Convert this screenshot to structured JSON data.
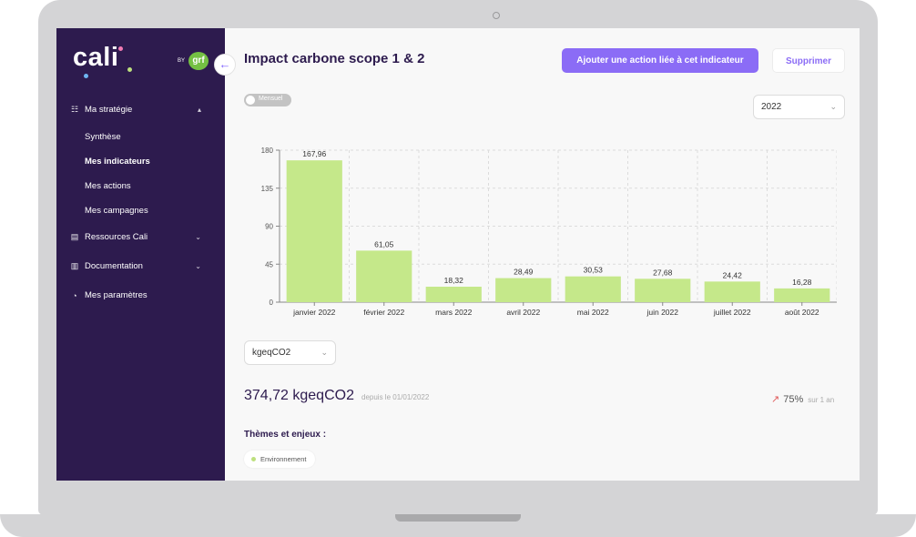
{
  "app": {
    "logo_text": "cali",
    "by_label": "BY",
    "partner_logo": "grf",
    "colors": {
      "sidebar": "#2d1b4e",
      "accent": "#8b6cf6",
      "bar": "#c5e88a",
      "partner": "#74c043"
    }
  },
  "sidebar": {
    "collapse_icon": "arrow-left-icon",
    "items": [
      {
        "label": "Ma stratégie",
        "icon": "strategy-icon",
        "expanded": true
      },
      {
        "label": "Ressources Cali",
        "icon": "book-icon",
        "expanded": false
      },
      {
        "label": "Documentation",
        "icon": "document-icon",
        "expanded": false
      },
      {
        "label": "Mes paramètres",
        "icon": "settings-icon"
      }
    ],
    "subitems": [
      {
        "label": "Synthèse",
        "active": false
      },
      {
        "label": "Mes indicateurs",
        "active": true
      },
      {
        "label": "Mes actions",
        "active": false
      },
      {
        "label": "Mes campagnes",
        "active": false
      }
    ]
  },
  "header": {
    "title": "Impact carbone scope 1 & 2",
    "add_action_label": "Ajouter une action liée à cet indicateur",
    "delete_label": "Supprimer"
  },
  "filters": {
    "toggle_label": "Mensuel",
    "toggle_on": false,
    "year": "2022",
    "unit": "kgeqCO2"
  },
  "chart_data": {
    "type": "bar",
    "categories": [
      "janvier 2022",
      "février 2022",
      "mars 2022",
      "avril 2022",
      "mai 2022",
      "juin 2022",
      "juillet 2022",
      "août 2022"
    ],
    "values": [
      167.96,
      61.05,
      18.32,
      28.49,
      30.53,
      27.68,
      24.42,
      16.28
    ],
    "value_labels": [
      "167,96",
      "61,05",
      "18,32",
      "28,49",
      "30,53",
      "27,68",
      "24,42",
      "16,28"
    ],
    "yticks": [
      0,
      45,
      90,
      135,
      180
    ],
    "ylim": [
      0,
      180
    ],
    "grid": true
  },
  "summary": {
    "total": "374,72 kgeqCO2",
    "since": "depuis le 01/01/2022",
    "trend_pct": "75%",
    "trend_period": "sur 1 an"
  },
  "themes": {
    "title": "Thèmes et enjeux :",
    "tags": [
      "Environnement"
    ]
  }
}
